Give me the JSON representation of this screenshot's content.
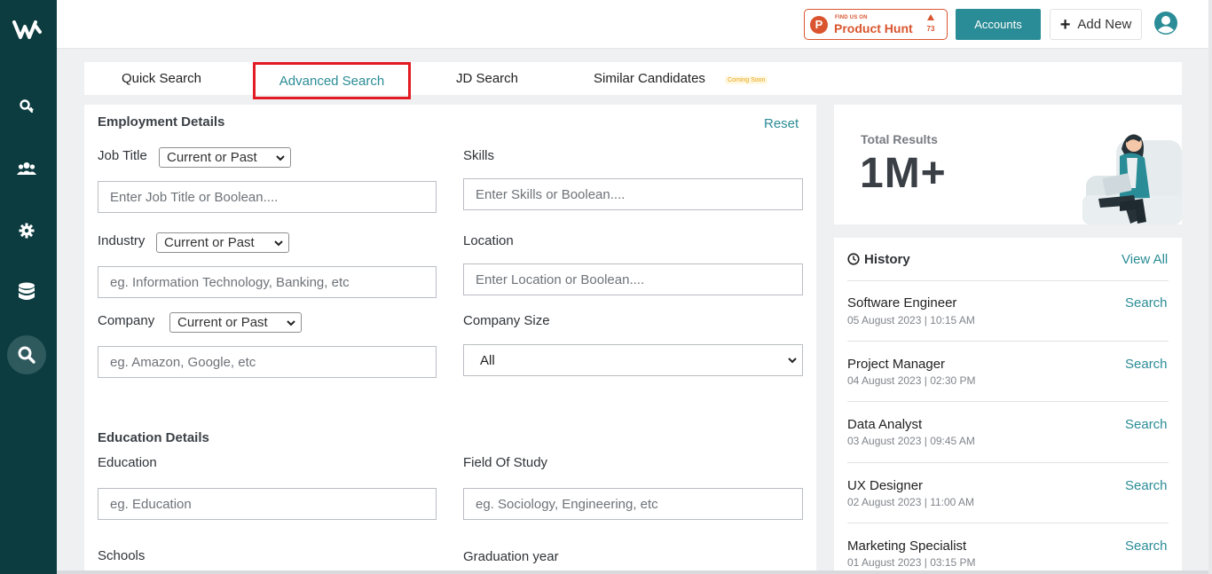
{
  "colors": {
    "sidebar": "#0c3c40",
    "accent": "#2a8c96",
    "highlight": "#e31b23",
    "product_hunt": "#da552f"
  },
  "header": {
    "product_hunt": {
      "small": "FIND US ON",
      "name": "Product Hunt",
      "count": "73"
    },
    "accounts_label": "Accounts",
    "add_new_label": "Add New"
  },
  "tabs": [
    {
      "label": "Quick Search"
    },
    {
      "label": "Advanced Search",
      "active": true
    },
    {
      "label": "JD Search"
    },
    {
      "label": "Similar Candidates"
    }
  ],
  "coming_soon": "Coming Soon",
  "employment": {
    "title": "Employment Details",
    "reset": "Reset",
    "job_title": {
      "label": "Job Title",
      "select": "Current or Past",
      "placeholder": "Enter Job Title or Boolean...."
    },
    "skills": {
      "label": "Skills",
      "placeholder": "Enter Skills or Boolean...."
    },
    "industry": {
      "label": "Industry",
      "select": "Current or Past",
      "placeholder": "eg. Information Technology, Banking, etc"
    },
    "location": {
      "label": "Location",
      "placeholder": "Enter Location or Boolean...."
    },
    "company": {
      "label": "Company",
      "select": "Current or Past",
      "placeholder": "eg. Amazon, Google, etc"
    },
    "company_size": {
      "label": "Company Size",
      "value": "All"
    }
  },
  "education": {
    "title": "Education Details",
    "education": {
      "label": "Education",
      "placeholder": "eg. Education"
    },
    "field_of_study": {
      "label": "Field Of Study",
      "placeholder": "eg. Sociology, Engineering, etc"
    },
    "schools": {
      "label": "Schools"
    },
    "graduation_year": {
      "label": "Graduation year"
    }
  },
  "results": {
    "label": "Total Results",
    "value": "1M+"
  },
  "history": {
    "title": "History",
    "view_all": "View All",
    "items": [
      {
        "name": "Software Engineer",
        "date": "05 August 2023 | 10:15 AM",
        "action": "Search"
      },
      {
        "name": "Project Manager",
        "date": "04 August 2023 | 02:30 PM",
        "action": "Search"
      },
      {
        "name": "Data Analyst",
        "date": "03 August 2023 | 09:45 AM",
        "action": "Search"
      },
      {
        "name": "UX Designer",
        "date": "02 August 2023 | 11:00 AM",
        "action": "Search"
      },
      {
        "name": "Marketing Specialist",
        "date": "01 August 2023 | 03:15 PM",
        "action": "Search"
      }
    ]
  },
  "icons": [
    "logo-w-icon",
    "search-key-icon",
    "users-icon",
    "gear-icon",
    "database-icon",
    "search-icon",
    "user-avatar-icon",
    "clock-icon",
    "chevron-down-icon"
  ]
}
